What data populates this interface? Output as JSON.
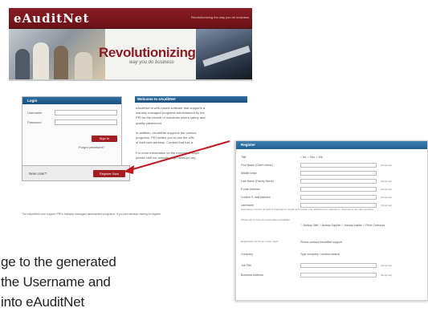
{
  "site": {
    "logo": "eAuditNet",
    "tagline": "Revolutionizing the way you do business",
    "hero_title": "Revolutionizing the",
    "hero_subtitle": "way you do business",
    "login": {
      "header": "Login",
      "username_label": "Username",
      "password_label": "Password",
      "signin_label": "Sign In",
      "forgot_label": "Forgot password?"
    },
    "register": {
      "prompt": "New User?",
      "button": "Register Now"
    },
    "welcome": {
      "title": "Welcome to eAuditNet",
      "lines": [
        "eAuditNet is web-based software that supports a",
        "industry managed programs administered by the",
        "PRI for the benefit of industries where safety and",
        "quality paramount.",
        "",
        "In addition, eAuditNet supports the various",
        "programs. PRI invites you to use the URL",
        "of their web address. Content that has a",
        "",
        "For more information on the innovative ways",
        "please visit our website: http://www.pri.org"
      ]
    },
    "footer": "The eAuditNet.com support PRI's industry managed assessment programs. If you are already visiting to register"
  },
  "register_form": {
    "header": "Register",
    "fields": [
      {
        "label": "Title",
        "type": "radio",
        "options": "○ Mr. ○ Mrs. ○ Ms."
      },
      {
        "label": "First Name (Given Name)",
        "type": "text",
        "req": "(Required)"
      },
      {
        "label": "Middle Initial",
        "type": "text",
        "req": ""
      },
      {
        "label": "Last Name (Family Name)",
        "type": "text",
        "req": "(Required)"
      },
      {
        "label": "E-mail Address",
        "type": "text",
        "req": "(Required)"
      },
      {
        "label": "Confirm E-mail Address",
        "type": "text",
        "req": "(Required)"
      },
      {
        "label": "Username",
        "type": "text",
        "req": "(Required)"
      }
    ],
    "username_note": "Usernames must be at least 6 characters in length and contain only alphanumeric characters. Usernames are case sensitive.",
    "company_label": "Please tell us how you heard about eAuditNet",
    "checkboxes": "☐ Nadcap Staff  ☐ Nadcap Supplier  ☐ Nadcap Auditor  ☐ Prime Contractor",
    "contact_label": "Registration for Prime / other users",
    "contact_value": "Please contact eAuditNet support",
    "company_field": {
      "label": "Company",
      "value": "Type company / location search"
    },
    "job_title": {
      "label": "Job Title",
      "req": "(Required)"
    },
    "address": {
      "label": "Business Address",
      "req": "(Required)"
    }
  },
  "caption": {
    "line1": "ge to the generated",
    "line2": "the Username and",
    "line3": "into eAuditNet"
  }
}
